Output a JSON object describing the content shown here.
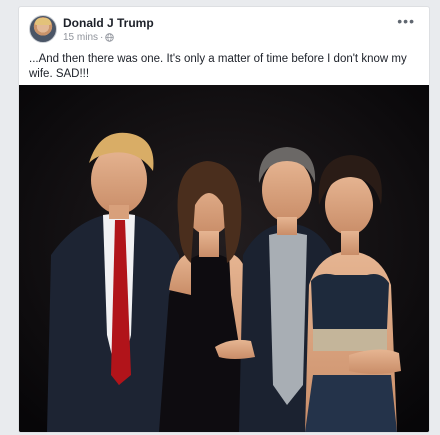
{
  "post": {
    "author": "Donald J Trump",
    "timestamp": "15 mins",
    "separator": "·",
    "more_label": "•••",
    "text": "...And then there was one. It's only a matter of time before I don't know my wife. SAD!!!"
  },
  "icons": {
    "avatar": "profile-photo",
    "audience": "globe-icon",
    "options": "more-options-icon"
  },
  "colors": {
    "page_background": "#e9ebee",
    "card_background": "#ffffff",
    "author_text": "#1d2129",
    "meta_text": "#90949c"
  }
}
